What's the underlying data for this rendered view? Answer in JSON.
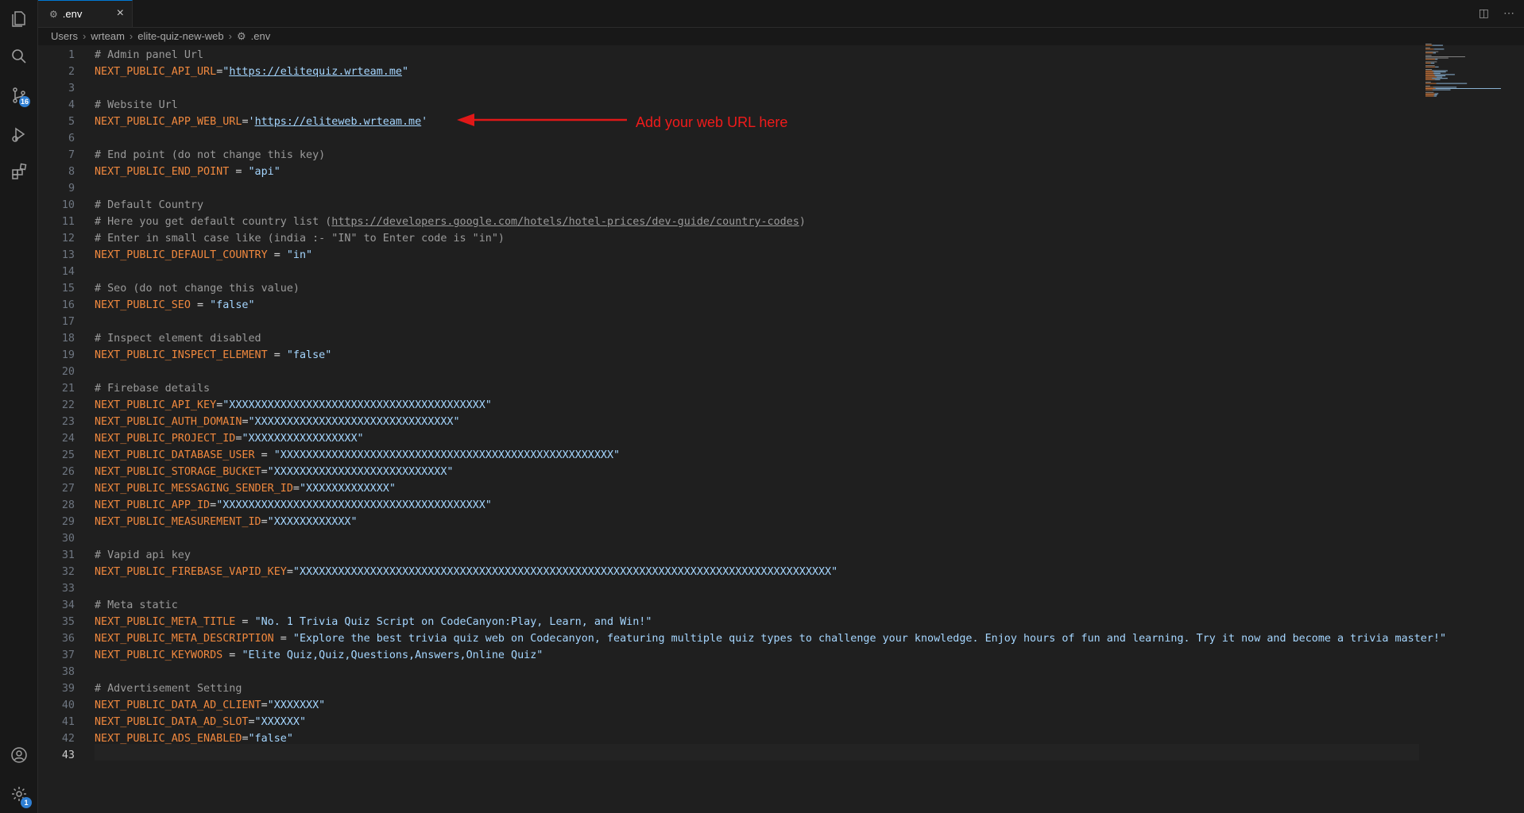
{
  "activity_bar": {
    "source_control_badge": "16",
    "settings_badge": "1"
  },
  "tab": {
    "title": ".env",
    "close": "×"
  },
  "tab_actions": {
    "split": "◫",
    "more": "⋯"
  },
  "breadcrumb": {
    "items": [
      "Users",
      "wrteam",
      "elite-quiz-new-web",
      ".env"
    ],
    "separator": "›"
  },
  "annotation": {
    "text": "Add your web URL here",
    "color": "#f01b1b"
  },
  "colors": {
    "comment": "#9a9a9a",
    "key": "#f0883e",
    "string": "#a5d6ff",
    "accent": "#0078d4"
  },
  "current_line": 43,
  "lines": [
    [
      [
        "cm",
        "# Admin panel Url"
      ]
    ],
    [
      [
        "key",
        "NEXT_PUBLIC_API_URL"
      ],
      [
        "op",
        "="
      ],
      [
        "str",
        "\""
      ],
      [
        "str url",
        "https://elitequiz.wrteam.me"
      ],
      [
        "str",
        "\""
      ]
    ],
    [],
    [
      [
        "cm",
        "# Website Url"
      ]
    ],
    [
      [
        "key",
        "NEXT_PUBLIC_APP_WEB_URL"
      ],
      [
        "op",
        "="
      ],
      [
        "str",
        "'"
      ],
      [
        "str url",
        "https://eliteweb.wrteam.me"
      ],
      [
        "str",
        "'"
      ]
    ],
    [],
    [
      [
        "cm",
        "# End point (do not change this key)"
      ]
    ],
    [
      [
        "key",
        "NEXT_PUBLIC_END_POINT"
      ],
      [
        "op",
        " = "
      ],
      [
        "str",
        "\"api\""
      ]
    ],
    [],
    [
      [
        "cm",
        "# Default Country"
      ]
    ],
    [
      [
        "cm",
        "# Here you get default country list ("
      ],
      [
        "cm url",
        "https://developers.google.com/hotels/hotel-prices/dev-guide/country-codes"
      ],
      [
        "cm",
        ")"
      ]
    ],
    [
      [
        "cm",
        "# Enter in small case like (india :- \"IN\" to Enter code is \"in\")"
      ]
    ],
    [
      [
        "key",
        "NEXT_PUBLIC_DEFAULT_COUNTRY"
      ],
      [
        "op",
        " = "
      ],
      [
        "str",
        "\"in\""
      ]
    ],
    [],
    [
      [
        "cm",
        "# Seo (do not change this value)"
      ]
    ],
    [
      [
        "key",
        "NEXT_PUBLIC_SEO"
      ],
      [
        "op",
        " = "
      ],
      [
        "str",
        "\"false\""
      ]
    ],
    [],
    [
      [
        "cm",
        "# Inspect element disabled"
      ]
    ],
    [
      [
        "key",
        "NEXT_PUBLIC_INSPECT_ELEMENT"
      ],
      [
        "op",
        " = "
      ],
      [
        "str",
        "\"false\""
      ]
    ],
    [],
    [
      [
        "cm",
        "# Firebase details"
      ]
    ],
    [
      [
        "key",
        "NEXT_PUBLIC_API_KEY"
      ],
      [
        "op",
        "="
      ],
      [
        "str",
        "\"XXXXXXXXXXXXXXXXXXXXXXXXXXXXXXXXXXXXXXXX\""
      ]
    ],
    [
      [
        "key",
        "NEXT_PUBLIC_AUTH_DOMAIN"
      ],
      [
        "op",
        "="
      ],
      [
        "str",
        "\"XXXXXXXXXXXXXXXXXXXXXXXXXXXXXXX\""
      ]
    ],
    [
      [
        "key",
        "NEXT_PUBLIC_PROJECT_ID"
      ],
      [
        "op",
        "="
      ],
      [
        "str",
        "\"XXXXXXXXXXXXXXXXX\""
      ]
    ],
    [
      [
        "key",
        "NEXT_PUBLIC_DATABASE_USER"
      ],
      [
        "op",
        " = "
      ],
      [
        "str",
        "\"XXXXXXXXXXXXXXXXXXXXXXXXXXXXXXXXXXXXXXXXXXXXXXXXXXXX\""
      ]
    ],
    [
      [
        "key",
        "NEXT_PUBLIC_STORAGE_BUCKET"
      ],
      [
        "op",
        "="
      ],
      [
        "str",
        "\"XXXXXXXXXXXXXXXXXXXXXXXXXXX\""
      ]
    ],
    [
      [
        "key",
        "NEXT_PUBLIC_MESSAGING_SENDER_ID"
      ],
      [
        "op",
        "="
      ],
      [
        "str",
        "\"XXXXXXXXXXXXX\""
      ]
    ],
    [
      [
        "key",
        "NEXT_PUBLIC_APP_ID"
      ],
      [
        "op",
        "="
      ],
      [
        "str",
        "\"XXXXXXXXXXXXXXXXXXXXXXXXXXXXXXXXXXXXXXXXX\""
      ]
    ],
    [
      [
        "key",
        "NEXT_PUBLIC_MEASUREMENT_ID"
      ],
      [
        "op",
        "="
      ],
      [
        "str",
        "\"XXXXXXXXXXXX\""
      ]
    ],
    [],
    [
      [
        "cm",
        "# Vapid api key"
      ]
    ],
    [
      [
        "key",
        "NEXT_PUBLIC_FIREBASE_VAPID_KEY"
      ],
      [
        "op",
        "="
      ],
      [
        "str",
        "\"XXXXXXXXXXXXXXXXXXXXXXXXXXXXXXXXXXXXXXXXXXXXXXXXXXXXXXXXXXXXXXXXXXXXXXXXXXXXXXXXXXX\""
      ]
    ],
    [],
    [
      [
        "cm",
        "# Meta static"
      ]
    ],
    [
      [
        "key",
        "NEXT_PUBLIC_META_TITLE"
      ],
      [
        "op",
        " = "
      ],
      [
        "str",
        "\"No. 1 Trivia Quiz Script on CodeCanyon:Play, Learn, and Win!\""
      ]
    ],
    [
      [
        "key",
        "NEXT_PUBLIC_META_DESCRIPTION"
      ],
      [
        "op",
        " = "
      ],
      [
        "str",
        "\"Explore the best trivia quiz web on Codecanyon, featuring multiple quiz types to challenge your knowledge. Enjoy hours of fun and learning. Try it now and become a trivia master!\""
      ]
    ],
    [
      [
        "key",
        "NEXT_PUBLIC_KEYWORDS"
      ],
      [
        "op",
        " = "
      ],
      [
        "str",
        "\"Elite Quiz,Quiz,Questions,Answers,Online Quiz\""
      ]
    ],
    [],
    [
      [
        "cm",
        "# Advertisement Setting"
      ]
    ],
    [
      [
        "key",
        "NEXT_PUBLIC_DATA_AD_CLIENT"
      ],
      [
        "op",
        "="
      ],
      [
        "str",
        "\"XXXXXXX\""
      ]
    ],
    [
      [
        "key",
        "NEXT_PUBLIC_DATA_AD_SLOT"
      ],
      [
        "op",
        "="
      ],
      [
        "str",
        "\"XXXXXX\""
      ]
    ],
    [
      [
        "key",
        "NEXT_PUBLIC_ADS_ENABLED"
      ],
      [
        "op",
        "="
      ],
      [
        "str",
        "\"false\""
      ]
    ],
    []
  ]
}
